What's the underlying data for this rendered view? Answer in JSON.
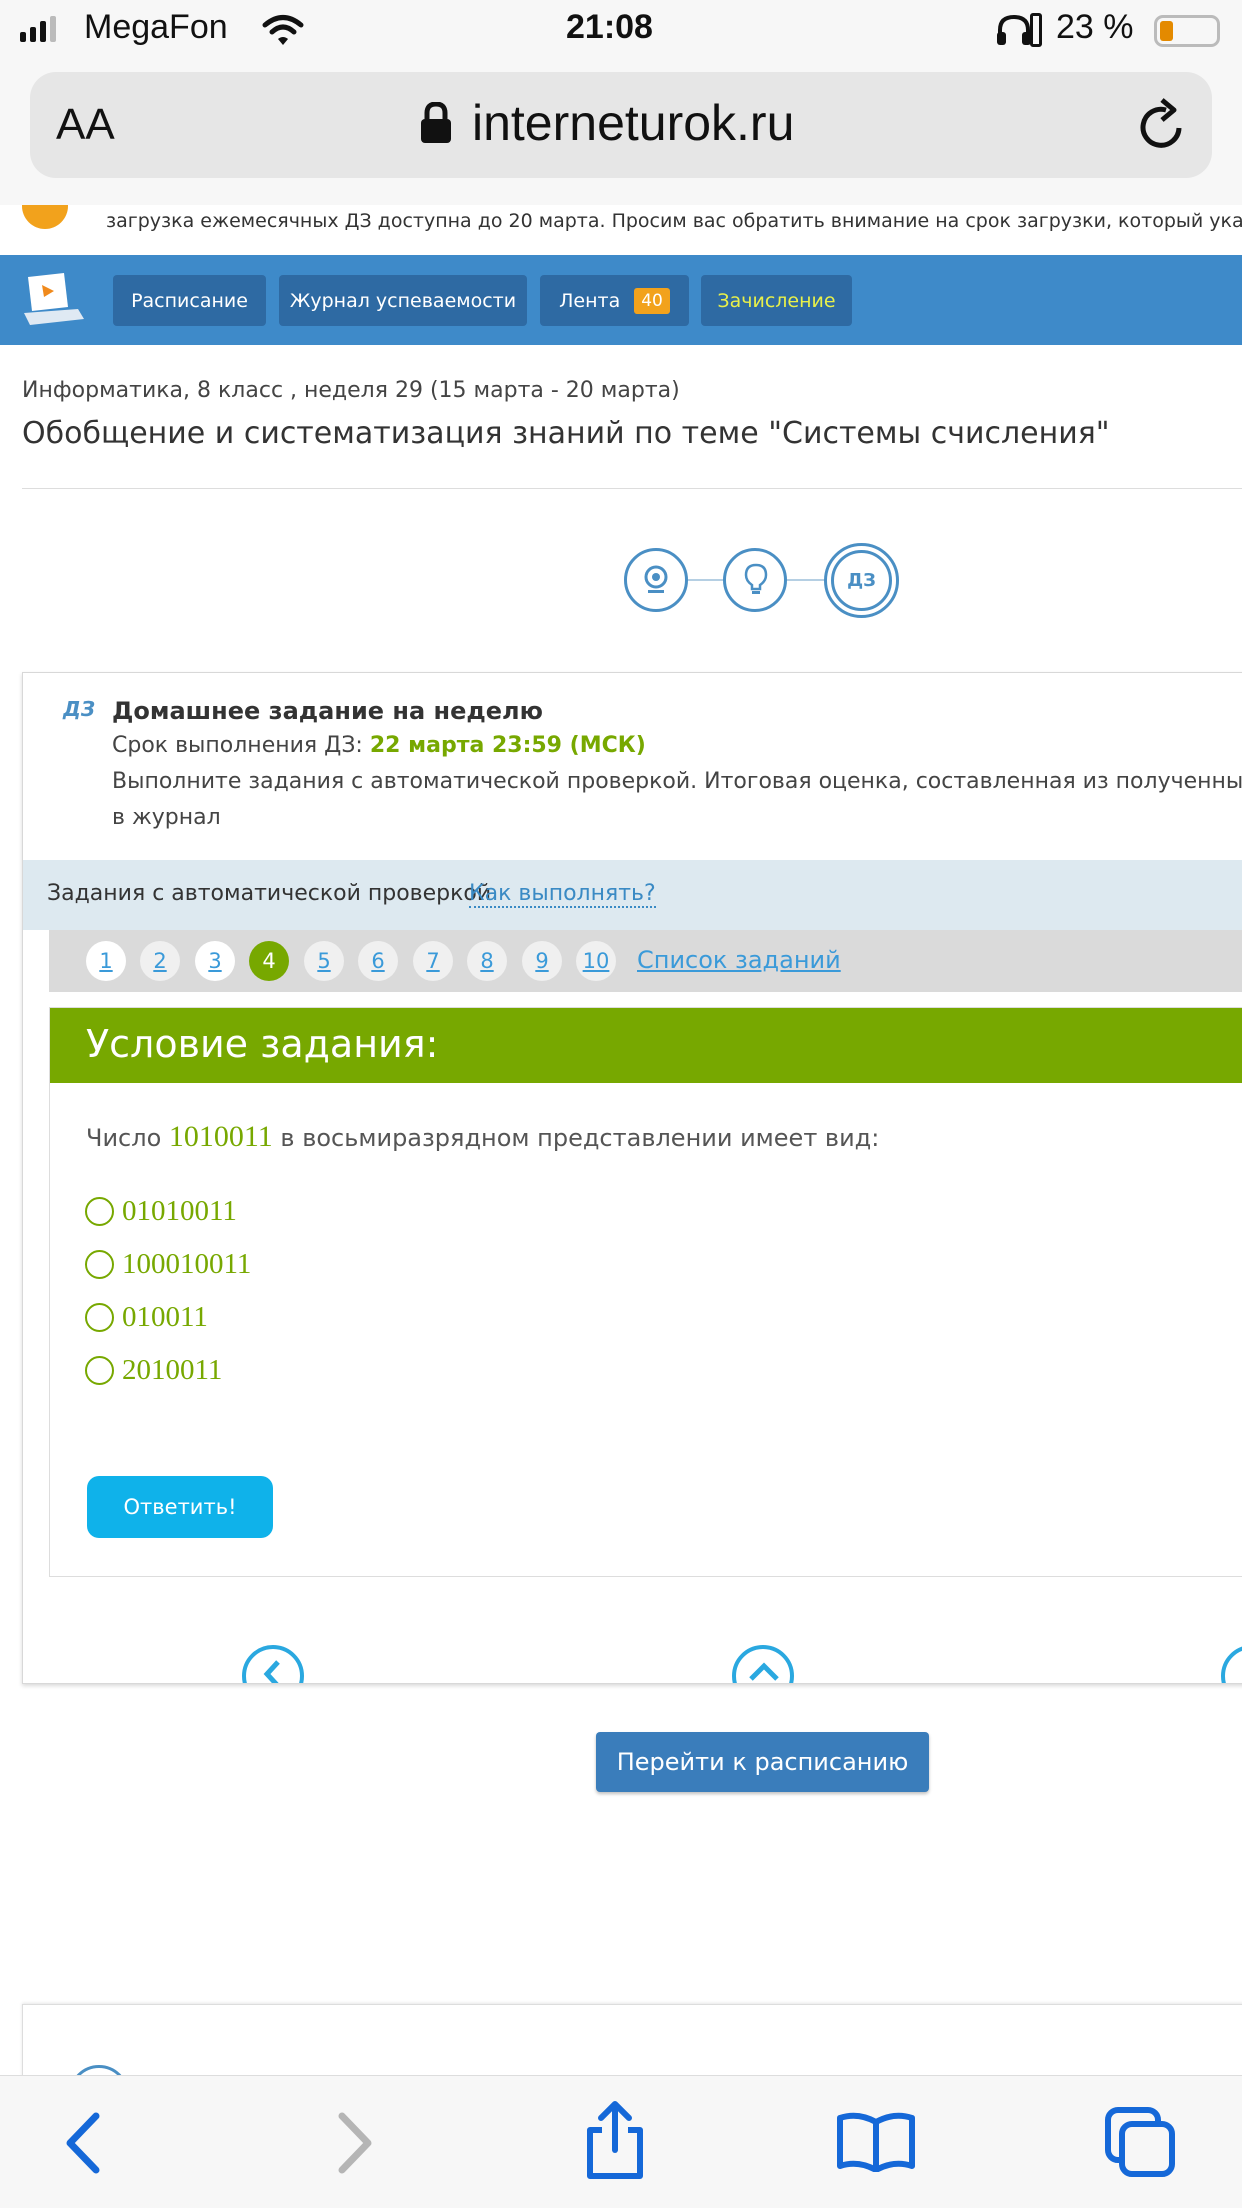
{
  "status": {
    "carrier": "MegaFon",
    "time": "21:08",
    "battery": "23 %"
  },
  "browser": {
    "aa_label": "AA",
    "url": "interneturok.ru"
  },
  "notice": {
    "text": "загрузка ежемесячных ДЗ доступна до 20 марта. Просим вас обратить внимание на срок загрузки, который указан в каждо"
  },
  "nav": {
    "schedule": "Расписание",
    "journal": "Журнал успеваемости",
    "feed": "Лента",
    "feed_count": "40",
    "enrollment": "Зачисление"
  },
  "lesson": {
    "meta": "Информатика, 8 класс , неделя 29 (15 марта - 20 марта)",
    "title": "Обобщение и систематизация знаний по теме \"Системы счисления\""
  },
  "steps": {
    "dz_label": "ДЗ"
  },
  "homework": {
    "badge": "ДЗ",
    "title": "Домашнее задание на неделю",
    "deadline_label": "Срок выполнения ДЗ: ",
    "deadline_value": "22 марта 23:59 (МСК)",
    "desc_line1": "Выполните задания с автоматической проверкой. Итоговая оценка, составленная из полученных баллов, бу",
    "desc_line2": "в журнал"
  },
  "auto_tasks": {
    "label": "Задания с автоматической проверкой",
    "how_link": "Как выполнять?"
  },
  "pagination": {
    "pages": [
      "1",
      "2",
      "3",
      "4",
      "5",
      "6",
      "7",
      "8",
      "9",
      "10"
    ],
    "active": "4",
    "list_link": "Список заданий"
  },
  "task": {
    "header": "Условие задания:",
    "question_prefix": "Число ",
    "question_number": "1010011",
    "question_suffix": " в восьмиразрядном представлении имеет вид:",
    "options": [
      "01010011",
      "100010011",
      "010011",
      "2010011"
    ],
    "answer_button": "Ответить!"
  },
  "go_schedule": "Перейти к расписанию",
  "colors": {
    "nav": "#3e8ac9",
    "green": "#77a800",
    "accent_blue": "#1aacea"
  }
}
